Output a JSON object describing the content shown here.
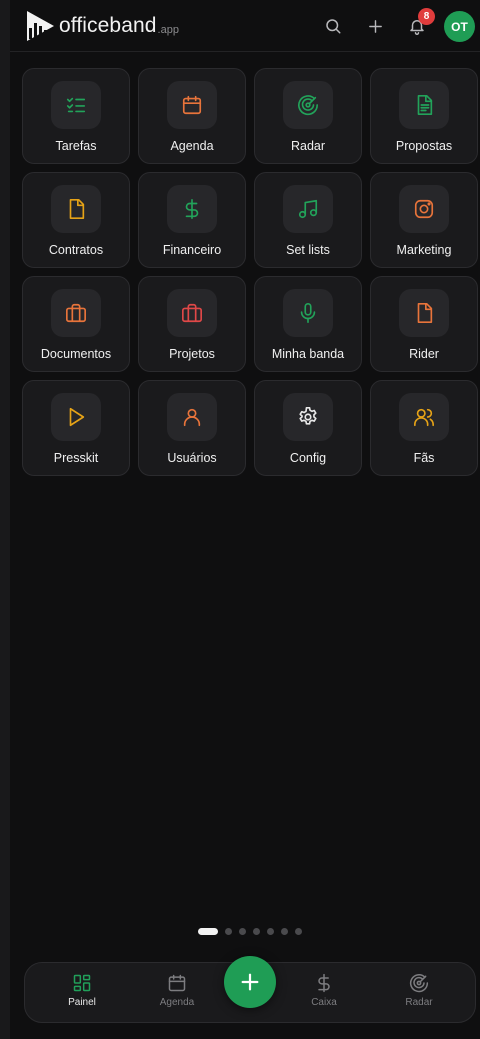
{
  "header": {
    "logo_text": "officeband",
    "logo_suffix": ".app",
    "notification_count": "8",
    "avatar_initials": "OT"
  },
  "tiles": [
    {
      "label": "Tarefas",
      "icon": "list-check-icon",
      "color": "#22a35a"
    },
    {
      "label": "Agenda",
      "icon": "calendar-icon",
      "color": "#e8743b"
    },
    {
      "label": "Radar",
      "icon": "radar-icon",
      "color": "#22a35a"
    },
    {
      "label": "Propostas",
      "icon": "file-text-icon",
      "color": "#22a35a"
    },
    {
      "label": "Contratos",
      "icon": "file-icon",
      "color": "#e6a317"
    },
    {
      "label": "Financeiro",
      "icon": "dollar-icon",
      "color": "#22a35a"
    },
    {
      "label": "Set lists",
      "icon": "music-icon",
      "color": "#22a35a"
    },
    {
      "label": "Marketing",
      "icon": "instagram-icon",
      "color": "#e8743b"
    },
    {
      "label": "Documentos",
      "icon": "briefcase-icon",
      "color": "#e8743b"
    },
    {
      "label": "Projetos",
      "icon": "briefcase-icon",
      "color": "#e04848"
    },
    {
      "label": "Minha banda",
      "icon": "microphone-icon",
      "color": "#22a35a"
    },
    {
      "label": "Rider",
      "icon": "file-icon",
      "color": "#e8743b"
    },
    {
      "label": "Presskit",
      "icon": "play-icon",
      "color": "#e6a317"
    },
    {
      "label": "Usuários",
      "icon": "user-icon",
      "color": "#e8743b"
    },
    {
      "label": "Config",
      "icon": "gear-icon",
      "color": "#e8e8e8"
    },
    {
      "label": "Fãs",
      "icon": "users-icon",
      "color": "#e6a317"
    }
  ],
  "pager": {
    "pages": 7,
    "active": 1
  },
  "bottom_nav": {
    "painel": "Painel",
    "agenda": "Agenda",
    "caixa": "Caixa",
    "radar": "Radar"
  },
  "colors": {
    "accent": "#1f9d55",
    "badge": "#e03c3c"
  }
}
